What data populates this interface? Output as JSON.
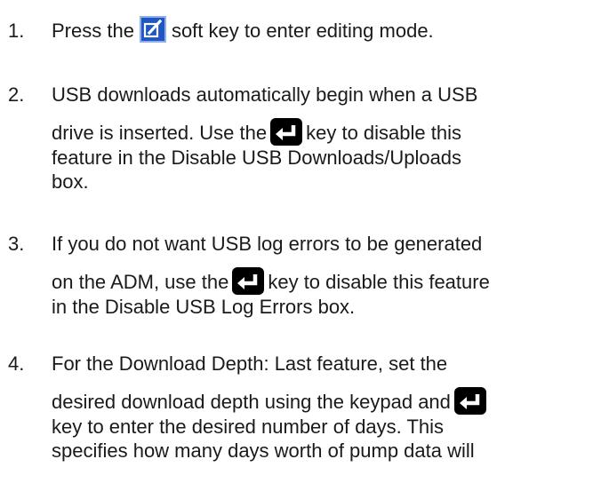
{
  "steps": [
    {
      "number": "1.",
      "line1_before": "Press the",
      "line1_after": "soft key to enter editing mode.",
      "icon": "edit-softkey-icon"
    },
    {
      "number": "2.",
      "line1": "USB downloads automatically begin when a USB",
      "line2_before": "drive is inserted. Use the",
      "line2_after": "key to disable this",
      "line3": "feature in the Disable USB Downloads/Uploads",
      "line4": "box.",
      "icon": "enter-key-icon"
    },
    {
      "number": "3.",
      "line1": "If you do not want USB log errors to be generated",
      "line2_before": "on the ADM, use the",
      "line2_after": "key to disable this feature",
      "line3": "in the Disable USB Log Errors box.",
      "icon": "enter-key-icon"
    },
    {
      "number": "4.",
      "line1": "For the Download Depth: Last feature, set the",
      "line2_before": "desired download depth using the keypad and",
      "line3": "key to enter the desired number of days. This",
      "line4": "specifies how many days worth of pump data will",
      "icon": "enter-key-icon"
    }
  ],
  "colors": {
    "text": "#1a1a1a",
    "edit_icon_bg": "#1f56c2",
    "enter_key_bg": "#000000"
  }
}
